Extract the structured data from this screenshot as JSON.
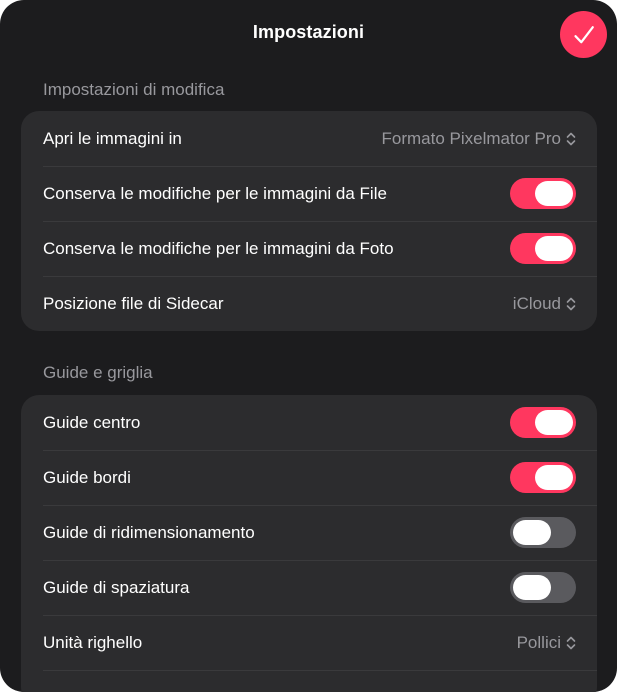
{
  "title": "Impostazioni",
  "colors": {
    "accent": "#ff375f",
    "background": "#1c1c1e",
    "group_background": "#2c2c2e",
    "toggle_off": "#5a5a5e"
  },
  "icons": {
    "done": "checkmark-icon",
    "popup": "chevron-up-down-icon"
  },
  "sections": [
    {
      "header": "Impostazioni di modifica",
      "rows": [
        {
          "label": "Apri le immagini in",
          "control": "popup",
          "value": "Formato Pixelmator Pro"
        },
        {
          "label": "Conserva le modifiche per le immagini da File",
          "control": "toggle",
          "on": true
        },
        {
          "label": "Conserva le modifiche per le immagini da Foto",
          "control": "toggle",
          "on": true
        },
        {
          "label": "Posizione file di Sidecar",
          "control": "popup",
          "value": "iCloud"
        }
      ]
    },
    {
      "header": "Guide e griglia",
      "rows": [
        {
          "label": "Guide centro",
          "control": "toggle",
          "on": true
        },
        {
          "label": "Guide bordi",
          "control": "toggle",
          "on": true
        },
        {
          "label": "Guide di ridimensionamento",
          "control": "toggle",
          "on": false
        },
        {
          "label": "Guide di spaziatura",
          "control": "toggle",
          "on": false
        },
        {
          "label": "Unità righello",
          "control": "popup",
          "value": "Pollici"
        }
      ]
    }
  ]
}
